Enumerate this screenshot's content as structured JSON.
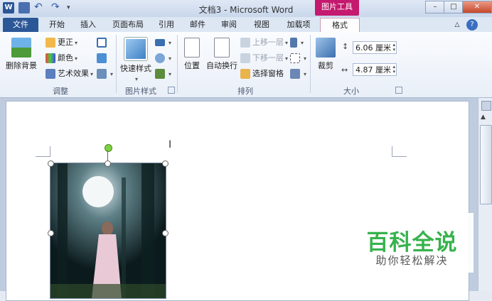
{
  "title": "文档3 - Microsoft Word",
  "context_tab": "图片工具",
  "window_controls": [
    "–",
    "□",
    "✕"
  ],
  "tabs": [
    "文件",
    "开始",
    "插入",
    "页面布局",
    "引用",
    "邮件",
    "审阅",
    "视图",
    "加载项",
    "格式"
  ],
  "active_tab": "格式",
  "ribbon": {
    "adjust": {
      "label": "调整",
      "remove_bg": "删除背景",
      "corrections": "更正",
      "color": "颜色",
      "artistic": "艺术效果"
    },
    "picture_styles": {
      "label": "图片样式",
      "quick_styles": "快速样式"
    },
    "arrange": {
      "label": "排列",
      "position": "位置",
      "wrap_text": "自动换行",
      "bring_forward": "上移一层",
      "send_backward": "下移一层",
      "selection_pane": "选择窗格"
    },
    "size": {
      "label": "大小",
      "crop": "裁剪",
      "height": "6.06 厘米",
      "width": "4.87 厘米"
    }
  },
  "watermark": {
    "title": "百科全说",
    "subtitle": "助你轻松解决"
  },
  "colors": {
    "file_tab": "#2b5797",
    "context_tab": "#c4196f",
    "watermark_green": "#37b24d"
  }
}
